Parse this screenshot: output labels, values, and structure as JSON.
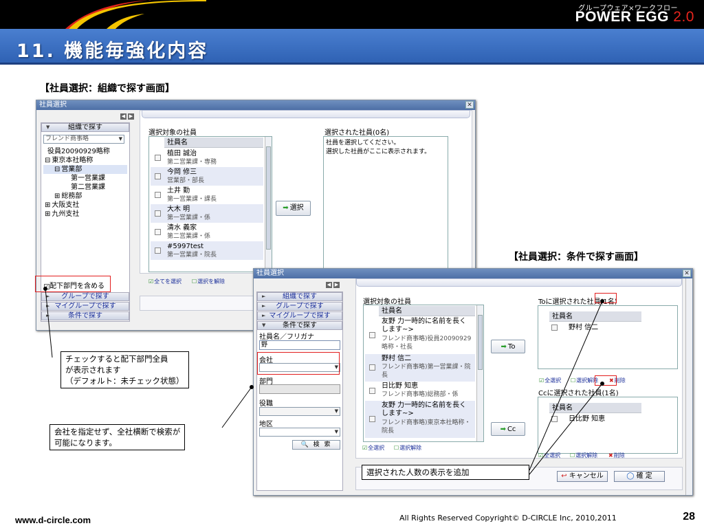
{
  "header": {
    "brand_sub": "グループウェア×ワークフロー",
    "brand": "POWER EGG",
    "brand_version": "2.0",
    "title": "11. 機能毎強化内容"
  },
  "captions": {
    "org_screen": "【社員選択：組織で探す画面】",
    "cond_screen": "【社員選択：条件で探す画面】"
  },
  "dialog1": {
    "title": "社員選択",
    "close": "✕",
    "accordion_org": "組織で探す",
    "org_select": "フレンド商事略",
    "tree": [
      {
        "text": "役員20090929略称",
        "indent": 6,
        "icon": "",
        "hl": false
      },
      {
        "text": "東京本社略称",
        "indent": 2,
        "icon": "⊟",
        "hl": false
      },
      {
        "text": "営業部",
        "indent": 16,
        "icon": "⊟",
        "hl": true
      },
      {
        "text": "第一営業課",
        "indent": 40,
        "icon": "",
        "hl": false
      },
      {
        "text": "第二営業課",
        "indent": 40,
        "icon": "",
        "hl": false
      },
      {
        "text": "総務部",
        "indent": 16,
        "icon": "⊞",
        "hl": false
      },
      {
        "text": "大阪支社",
        "indent": 2,
        "icon": "⊞",
        "hl": false
      },
      {
        "text": "九州支社",
        "indent": 2,
        "icon": "⊞",
        "hl": false
      }
    ],
    "include_sub": "配下部門を含める",
    "accordion_group": "グループで探す",
    "accordion_mygroup": "マイグループで探す",
    "accordion_cond": "条件で探す",
    "candidates_label": "選択対象の社員",
    "col_header": "社員名",
    "candidates": [
      {
        "name": "植田 誠治",
        "sub": "第二営業課・専務"
      },
      {
        "name": "今岡 修三",
        "sub": "営業部・部長"
      },
      {
        "name": "土井 勤",
        "sub": "第一営業課・課長"
      },
      {
        "name": "大木 明",
        "sub": "第一営業課・係"
      },
      {
        "name": "清水 義家",
        "sub": "第二営業課・係"
      },
      {
        "name": "#5997test",
        "sub": "第一営業課・院長"
      }
    ],
    "select_btn": "選択",
    "selected_label": "選択された社員(0名)",
    "empty_line1": "社員を選択してください。",
    "empty_line2": "選択した社員がここに表示されます。",
    "select_all": "全てを選択",
    "deselect_all": "選択を解除"
  },
  "dialog2": {
    "title": "社員選択",
    "close": "✕",
    "accordion_org": "組織で探す",
    "accordion_group": "グループで探す",
    "accordion_mygroup": "マイグループで探す",
    "accordion_cond": "条件で探す",
    "f_name_label": "社員名／フリガナ",
    "f_name_value": "野",
    "f_company_label": "会社",
    "f_company_value": "",
    "f_dept_label": "部門",
    "f_post_label": "役職",
    "f_area_label": "地区",
    "search_btn": "検 索",
    "candidates_label": "選択対象の社員",
    "col_header": "社員名",
    "candidates": [
      {
        "name": "友野 力一時的に名前を長く",
        "name2": "します~>",
        "sub": "フレンド商事略)役員20090929",
        "sub2": "略称・社長"
      },
      {
        "name": "野村 信二",
        "name2": "",
        "sub": "フレンド商事略)第一営業課・院",
        "sub2": "長"
      },
      {
        "name": "日比野 知恵",
        "name2": "",
        "sub": "フレンド商事略)総務部・係",
        "sub2": ""
      },
      {
        "name": "友野 力一時的に名前を長く",
        "name2": "します~>",
        "sub": "フレンド商事略)東京本社略称・",
        "sub2": "院長"
      }
    ],
    "to_btn": "To",
    "cc_btn": "Cc",
    "to_label": "Toに選択された社員",
    "to_count": "(1名)",
    "to_list": [
      "野村 信二"
    ],
    "cc_label": "Ccに選択された社員",
    "cc_count": "(1名)",
    "cc_list": [
      "日比野 知恵"
    ],
    "select_all": "全選択",
    "deselect_all": "選択解除",
    "remove": "削除",
    "cancel_btn": "キャンセル",
    "ok_btn": "確 定"
  },
  "callouts": {
    "sub_dept": [
      "チェックすると配下部門全員",
      "が表示されます",
      "（デフォルト：未チェック状態）"
    ],
    "company": [
      "会社を指定せず、全社横断で検索が",
      "可能になります。"
    ],
    "count": "選択された人数の表示を追加"
  },
  "footer": {
    "url": "www.d-circle.com",
    "copyright": "All Rights Reserved Copyright© D-CIRCLE Inc, 2010,2011",
    "page": "28"
  },
  "colors": {
    "accent_red": "#e21d1d",
    "title_blue": "#3a6fc4",
    "link_blue": "#1b2f9a"
  }
}
